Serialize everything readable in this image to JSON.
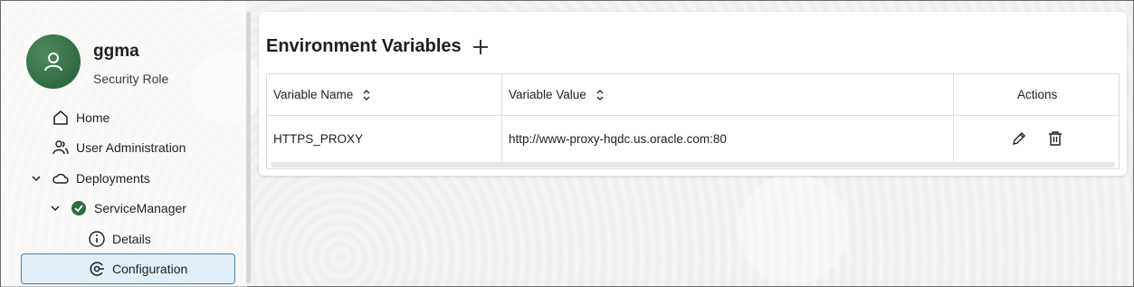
{
  "user": {
    "name": "ggma",
    "role": "Security Role"
  },
  "nav": {
    "home": "Home",
    "user_admin": "User Administration",
    "deployments": "Deployments",
    "service_manager": "ServiceManager",
    "details": "Details",
    "configuration": "Configuration"
  },
  "panel": {
    "title": "Environment Variables",
    "columns": {
      "name": "Variable Name",
      "value": "Variable Value",
      "actions": "Actions"
    },
    "rows": [
      {
        "name": "HTTPS_PROXY",
        "value": "http://www-proxy-hqdc.us.oracle.com:80"
      }
    ]
  },
  "colors": {
    "selected_bg": "#e2eef8",
    "selected_border": "#4e7fa7",
    "avatar": "#2e6a43",
    "status_ok": "#2e6a43"
  },
  "icons": {
    "add": "plus-icon",
    "edit": "pencil-icon",
    "delete": "trash-icon",
    "sort": "sort-icon"
  }
}
